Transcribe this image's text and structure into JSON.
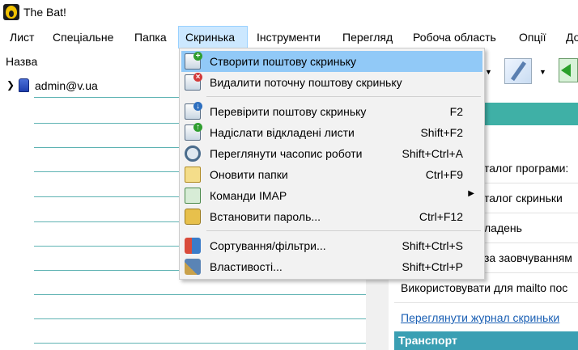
{
  "window": {
    "title": "The Bat!"
  },
  "menubar": {
    "items": [
      {
        "label": "Лист"
      },
      {
        "label": "Спеціальне"
      },
      {
        "label": "Папка"
      },
      {
        "label": "Скринька"
      },
      {
        "label": "Інструменти"
      },
      {
        "label": "Перегляд"
      },
      {
        "label": "Робоча область"
      },
      {
        "label": "Опції"
      },
      {
        "label": "До"
      }
    ],
    "active": "Скринька"
  },
  "folders": {
    "column_header": "Назва",
    "account": "admin@v.ua"
  },
  "dropdown": {
    "items": [
      {
        "label": "Створити поштову скриньку",
        "shortcut": "",
        "icon": "mailbox-add-icon"
      },
      {
        "label": "Видалити поточну поштову скриньку",
        "shortcut": "",
        "icon": "mailbox-delete-icon"
      },
      {
        "label": "Перевірити поштову скриньку",
        "shortcut": "F2",
        "icon": "check-mail-icon"
      },
      {
        "label": "Надіслати відкладені листи",
        "shortcut": "Shift+F2",
        "icon": "send-queued-icon"
      },
      {
        "label": "Переглянути часопис роботи",
        "shortcut": "Shift+Ctrl+A",
        "icon": "log-icon"
      },
      {
        "label": "Оновити папки",
        "shortcut": "Ctrl+F9",
        "icon": "refresh-folders-icon"
      },
      {
        "label": "Команди IMAP",
        "shortcut": "",
        "icon": "imap-icon"
      },
      {
        "label": "Встановити пароль...",
        "shortcut": "Ctrl+F12",
        "icon": "lock-icon"
      },
      {
        "label": "Сортування/фільтри...",
        "shortcut": "Shift+Ctrl+S",
        "icon": "sort-filters-icon"
      },
      {
        "label": "Властивості...",
        "shortcut": "Shift+Ctrl+P",
        "icon": "properties-icon"
      }
    ]
  },
  "right_pane": {
    "lines": [
      "талог програми:",
      "талог скриньки",
      "ладень",
      "за заовчуванням",
      "Використовувати для mailto пос"
    ],
    "link": "Переглянути журнал скриньки",
    "section": "Транспорт"
  },
  "colors": {
    "highlight": "#91c9f7",
    "menu_active": "#cce8ff",
    "teal": "#3fb0a6"
  }
}
